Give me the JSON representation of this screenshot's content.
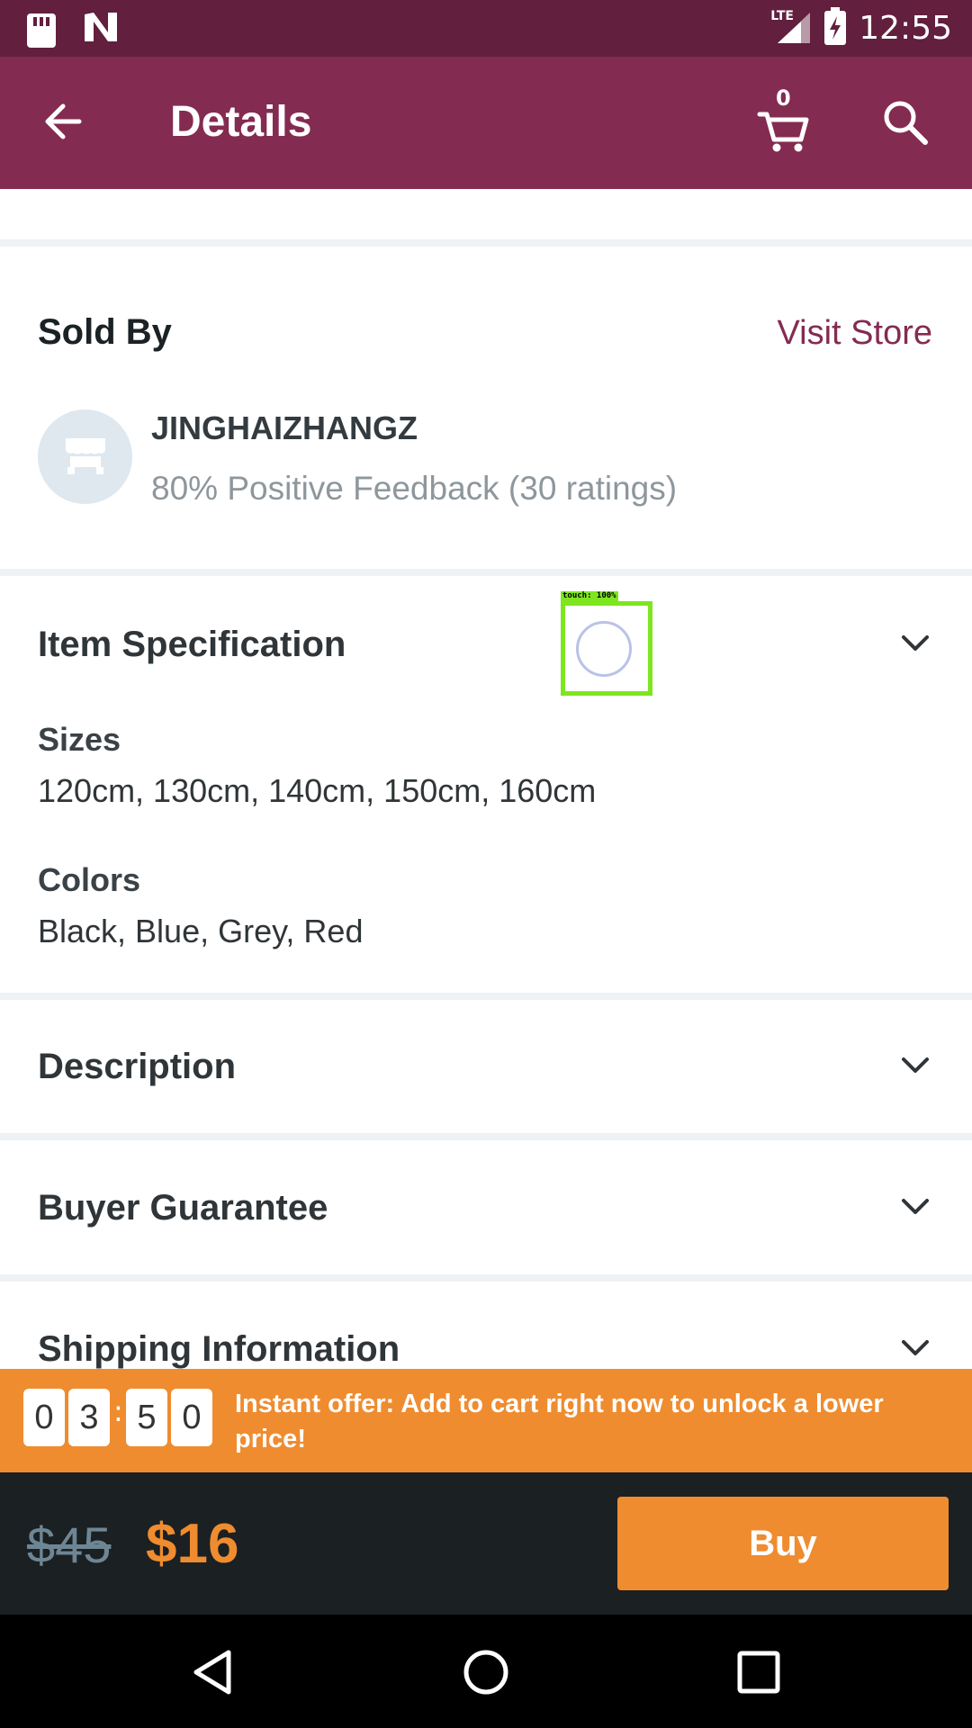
{
  "status_bar": {
    "network": "LTE",
    "time": "12:55"
  },
  "app_bar": {
    "title": "Details",
    "cart_count": "0"
  },
  "sold_by": {
    "title": "Sold By",
    "visit_store_label": "Visit Store",
    "store_name": "JINGHAIZHANGZ",
    "feedback": "80% Positive Feedback (30 ratings)"
  },
  "item_spec": {
    "title": "Item Specification",
    "sizes_label": "Sizes",
    "sizes_value": "120cm, 130cm, 140cm, 150cm, 160cm",
    "colors_label": "Colors",
    "colors_value": "Black, Blue, Grey, Red"
  },
  "sections": {
    "description": "Description",
    "buyer_guarantee": "Buyer Guarantee",
    "shipping_information": "Shipping Information"
  },
  "touch_overlay": {
    "label": "touch: 100%"
  },
  "offer": {
    "timer_digits": [
      "0",
      "3",
      "5",
      "0"
    ],
    "separator": ":",
    "text": "Instant offer: Add to cart right now to unlock a lower price!"
  },
  "price_bar": {
    "old_price": "$45",
    "new_price": "$16",
    "buy_label": "Buy"
  },
  "colors": {
    "brand": "#842b51",
    "status_bar": "#621f3e",
    "accent": "#ef8c2f",
    "price_bar_bg": "#1b2023"
  },
  "icons": [
    "sd-card-icon",
    "n-notification-icon",
    "signal-icon",
    "battery-charging-icon",
    "back-arrow-icon",
    "cart-icon",
    "search-icon",
    "store-icon",
    "chevron-down-icon",
    "nav-back-icon",
    "nav-home-icon",
    "nav-recents-icon"
  ]
}
